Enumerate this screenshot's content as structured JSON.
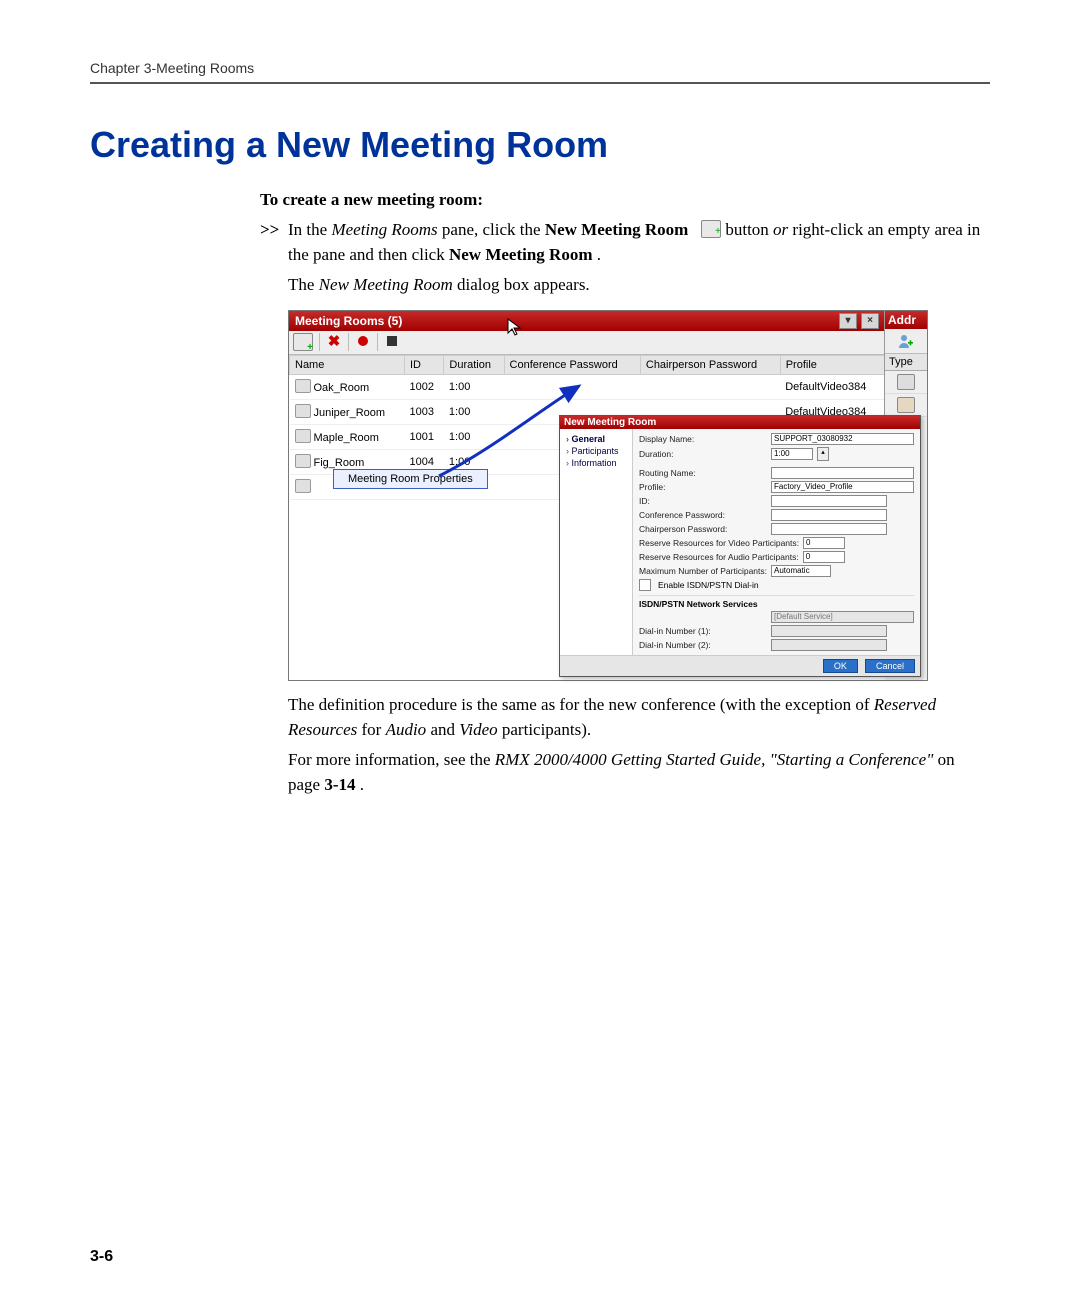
{
  "header": {
    "running": "Chapter 3-Meeting Rooms",
    "page_number": "3-6"
  },
  "title": "Creating a New Meeting Room",
  "procedure": {
    "lead": "To create a new meeting room:",
    "step_mark": ">>",
    "step1_pre": "In the ",
    "step1_pane_italic": "Meeting Rooms",
    "step1_mid": " pane, click the ",
    "step1_button_bold": "New Meeting Room",
    "step1_after_icon": " button ",
    "step1_or_italic": "or",
    "step1_tail_a": " right-click an empty area in the pane and then click ",
    "step1_tail_bold": "New Meeting Room",
    "step1_period": ".",
    "result_pre": "The ",
    "result_italic": "New Meeting Room",
    "result_post": " dialog box appears."
  },
  "shot": {
    "title": "Meeting Rooms (5)",
    "side_title": "Addr",
    "side_col": "Type",
    "columns": [
      "Name",
      "ID",
      "Duration",
      "Conference Password",
      "Chairperson Password",
      "Profile"
    ],
    "rows": [
      {
        "name": "Oak_Room",
        "id": "1002",
        "dur": "1:00",
        "conf": "",
        "chair": "",
        "profile": "DefaultVideo384"
      },
      {
        "name": "Juniper_Room",
        "id": "1003",
        "dur": "1:00",
        "conf": "",
        "chair": "",
        "profile": "DefaultVideo384"
      },
      {
        "name": "Maple_Room",
        "id": "1001",
        "dur": "1:00",
        "conf": "",
        "chair": "",
        "profile": ""
      },
      {
        "name": "Fig_Room",
        "id": "1004",
        "dur": "1:00",
        "conf": "",
        "chair": "",
        "profile": ""
      }
    ],
    "context_menu_item": "Meeting Room Properties",
    "dialog": {
      "title": "New Meeting Room",
      "nav": [
        "General",
        "Participants",
        "Information"
      ],
      "fields": {
        "display_name_label": "Display Name:",
        "display_name_value": "SUPPORT_03080932",
        "duration_label": "Duration:",
        "duration_value": "1:00",
        "routing_label": "Routing Name:",
        "profile_label": "Profile:",
        "profile_value": "Factory_Video_Profile",
        "id_label": "ID:",
        "conf_pw_label": "Conference Password:",
        "chair_pw_label": "Chairperson Password:",
        "video_res_label": "Reserve Resources for Video Participants:",
        "video_res_value": "0",
        "audio_res_label": "Reserve Resources for Audio Participants:",
        "audio_res_value": "0",
        "max_label": "Maximum Number of Participants:",
        "max_value": "Automatic",
        "enable_isdn_label": "Enable ISDN/PSTN Dial-in",
        "section_label": "ISDN/PSTN Network Services",
        "net_service_value": "[Default Service]",
        "dial1_label": "Dial-in Number (1):",
        "dial2_label": "Dial-in Number (2):"
      },
      "ok": "OK",
      "cancel": "Cancel"
    }
  },
  "after": {
    "p1_a": "The definition procedure is the same as for the new conference (with the exception of ",
    "p1_i1": "Reserved Resources",
    "p1_b": " for ",
    "p1_i2": "Audio",
    "p1_c": " and ",
    "p1_i3": "Video",
    "p1_d": " participants).",
    "p2_a": "For more information, see the ",
    "p2_i": "RMX 2000/4000 Getting Started Guide, \"Starting a Conference\"",
    "p2_b": " on page ",
    "p2_bold": "3-14",
    "p2_c": "."
  }
}
